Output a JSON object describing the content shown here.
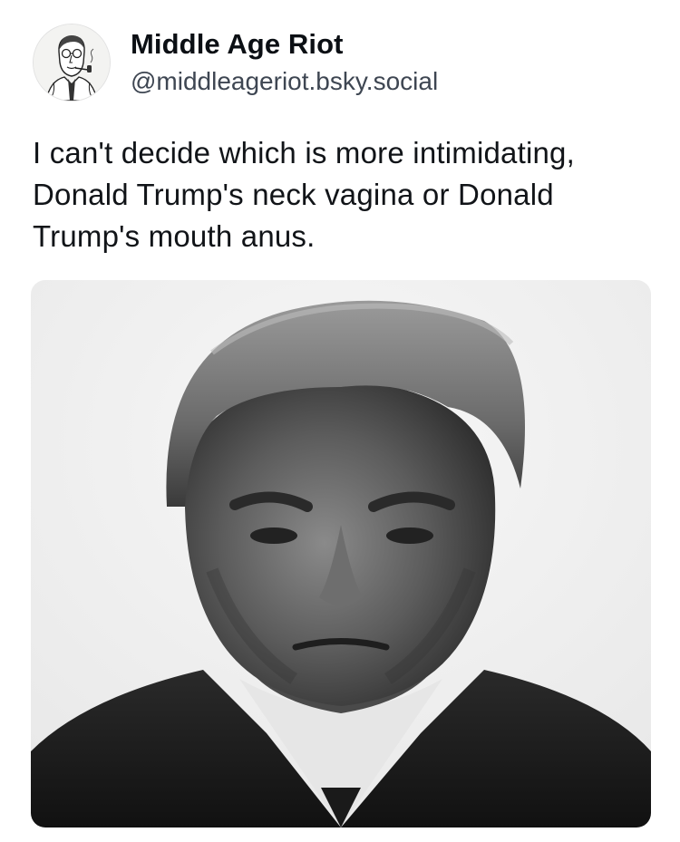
{
  "post": {
    "author": {
      "display_name": "Middle Age Riot",
      "handle": "@middleageriot.bsky.social",
      "avatar_icon": "cartoon-man-with-pipe-avatar"
    },
    "text": "I can't decide which is more intimidating, Donald Trump's neck vagina or Donald Trump's mouth anus.",
    "media": {
      "type": "photo",
      "style": "black-and-white portrait"
    }
  },
  "colors": {
    "text_primary": "#0b0f14",
    "text_secondary": "#3e4652",
    "background": "#ffffff"
  }
}
